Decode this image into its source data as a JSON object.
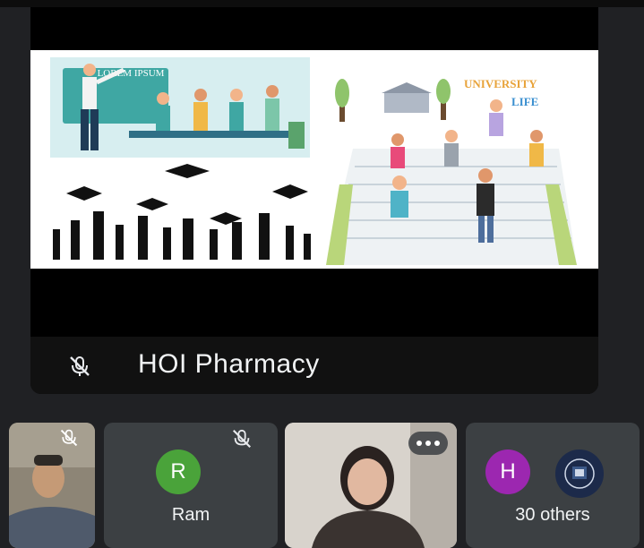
{
  "presenter": {
    "name": "HOI Pharmacy",
    "mic_icon": "mic-off-icon"
  },
  "slide": {
    "board_text": "LOREM IPSUM",
    "university_word1": "UNIVERSITY",
    "university_word2": "LIFE"
  },
  "participants": [
    {
      "type": "video",
      "name": ""
    },
    {
      "type": "avatar",
      "initial": "R",
      "name": "Ram",
      "avatar_color": "#4aa33a"
    },
    {
      "type": "video",
      "name": ""
    },
    {
      "type": "group",
      "initial": "H",
      "name": "30 others",
      "avatar_color": "#9c27b0"
    }
  ],
  "colors": {
    "background": "#202124",
    "tile": "#3c4043",
    "accent_teal": "#3fa7a3"
  }
}
